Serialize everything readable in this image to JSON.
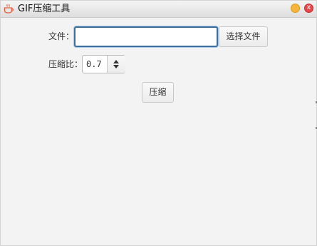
{
  "window": {
    "title": "GIF压缩工具",
    "app_icon": "coffee-cup-icon",
    "controls": {
      "minimize_color": "#f5b53a",
      "close_color": "#e8474a",
      "close_glyph": "x"
    }
  },
  "form": {
    "file_label": "文件：",
    "file_value": "",
    "choose_button": "选择文件",
    "ratio_label": "压缩比：",
    "ratio_value": "0.7",
    "compress_button": "压缩"
  },
  "colors": {
    "focus_border": "#3d6f9e",
    "background": "#f3f3f3"
  }
}
